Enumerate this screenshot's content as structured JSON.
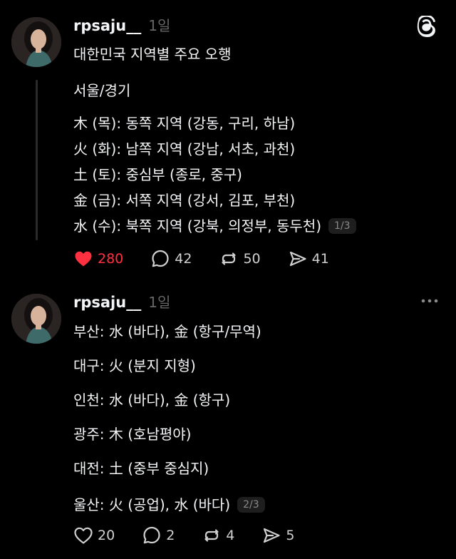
{
  "post1": {
    "username": "rpsaju__",
    "time": "1일",
    "lines": [
      "대한민국 지역별 주요 오행",
      "서울/경기",
      "木 (목): 동쪽 지역 (강동, 구리, 하남)",
      "火 (화): 남쪽 지역 (강남, 서초, 과천)",
      "土 (토): 중심부 (종로, 중구)",
      "金 (금): 서쪽 지역 (강서, 김포, 부천)",
      "水 (수): 북쪽 지역 (강북, 의정부, 동두천)"
    ],
    "pager": "1/3",
    "likes": "280",
    "comments": "42",
    "reposts": "50",
    "shares": "41"
  },
  "post2": {
    "username": "rpsaju__",
    "time": "1일",
    "lines": [
      "부산: 水 (바다), 金 (항구/무역)",
      "대구: 火 (분지 지형)",
      "인천: 水 (바다), 金 (항구)",
      "광주: 木 (호남평야)",
      "대전: 土 (중부 중심지)",
      "울산: 火 (공업), 水 (바다)"
    ],
    "pager": "2/3",
    "likes": "20",
    "comments": "2",
    "reposts": "4",
    "shares": "5"
  },
  "colors": {
    "background": "#000000",
    "text": "#f3f5f7",
    "muted": "#666666",
    "like_active": "#ff3040"
  },
  "icons": {
    "brand": "threads-logo-icon",
    "more": "more-horizontal-icon",
    "like": "heart-icon",
    "comment": "comment-bubble-icon",
    "repost": "repost-arrows-icon",
    "share": "send-arrow-icon"
  }
}
